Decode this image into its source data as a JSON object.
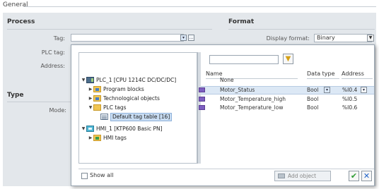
{
  "header": {
    "section_label": "General"
  },
  "process": {
    "title": "Process",
    "tag_label": "Tag:",
    "plc_tag_label": "PLC tag:",
    "address_label": "Address:"
  },
  "format": {
    "title": "Format",
    "display_format_label": "Display format:",
    "display_format_value": "Binary"
  },
  "type": {
    "title": "Type",
    "mode_label": "Mode:"
  },
  "popup": {
    "tree": [
      {
        "label": "PLC_1 [CPU 1214C DC/DC/DC]",
        "icon": "plc-icon",
        "expanded": true
      },
      {
        "label": "Program blocks",
        "icon": "folder-icon",
        "expanded": false
      },
      {
        "label": "Technological objects",
        "icon": "folder-icon",
        "expanded": false
      },
      {
        "label": "PLC tags",
        "icon": "folder-icon",
        "expanded": true
      },
      {
        "label": "Default tag table [16]",
        "icon": "tag-table-icon",
        "selected": true
      },
      {
        "label": "HMI_1 [KTP600 Basic PN]",
        "icon": "hmi-icon",
        "expanded": true
      },
      {
        "label": "HMI tags",
        "icon": "folder-icon",
        "expanded": false
      }
    ],
    "columns": {
      "name": "Name",
      "data_type": "Data type",
      "address": "Address"
    },
    "rows": [
      {
        "name": "None",
        "data_type": "",
        "address": ""
      },
      {
        "name": "Motor_Status",
        "data_type": "Bool",
        "address": "%I0.4"
      },
      {
        "name": "Motor_Temperature_high",
        "data_type": "Bool",
        "address": "%I0.5"
      },
      {
        "name": "Motor_Temperature_low",
        "data_type": "Bool",
        "address": "%I0.6"
      }
    ],
    "show_all_label": "Show all",
    "add_object_label": "Add object",
    "ok_symbol": "✔",
    "cancel_symbol": "✕"
  }
}
